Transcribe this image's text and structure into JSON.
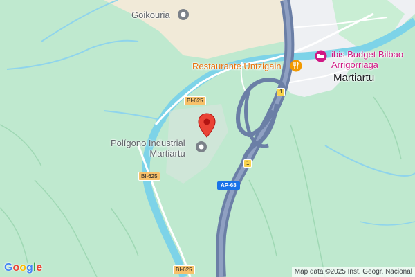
{
  "labels": {
    "goikouria": "Goikouria",
    "restaurant": "Restaurante Untzigain",
    "hotel_line1": "ibis Budget Bilbao",
    "hotel_line2": "Arrigorriaga",
    "town": "Martiartu",
    "industrial_line1": "Polígono Industrial",
    "industrial_line2": "Martiartu"
  },
  "road_shields": {
    "bi625_a": "BI-625",
    "bi625_b": "BI-625",
    "bi625_c": "BI-625",
    "ap68": "AP-68",
    "exit1_a": "1",
    "exit1_b": "1"
  },
  "logo": [
    "G",
    "o",
    "o",
    "g",
    "l",
    "e"
  ],
  "logo_colors": [
    "#4285f4",
    "#ea4335",
    "#fbbc05",
    "#4285f4",
    "#34a853",
    "#ea4335"
  ],
  "attribution": "Map data ©2025 Inst. Geogr. Nacional",
  "colors": {
    "forest": "#bfe9cf",
    "river": "#7dd3e8",
    "motorway": "#6b7fa6",
    "urban": "#eef0f3",
    "sand": "#f1ead8",
    "marker": "#ea4335"
  },
  "icons": [
    "location-pin-icon",
    "restaurant-icon",
    "hotel-icon",
    "poi-circle-icon"
  ]
}
